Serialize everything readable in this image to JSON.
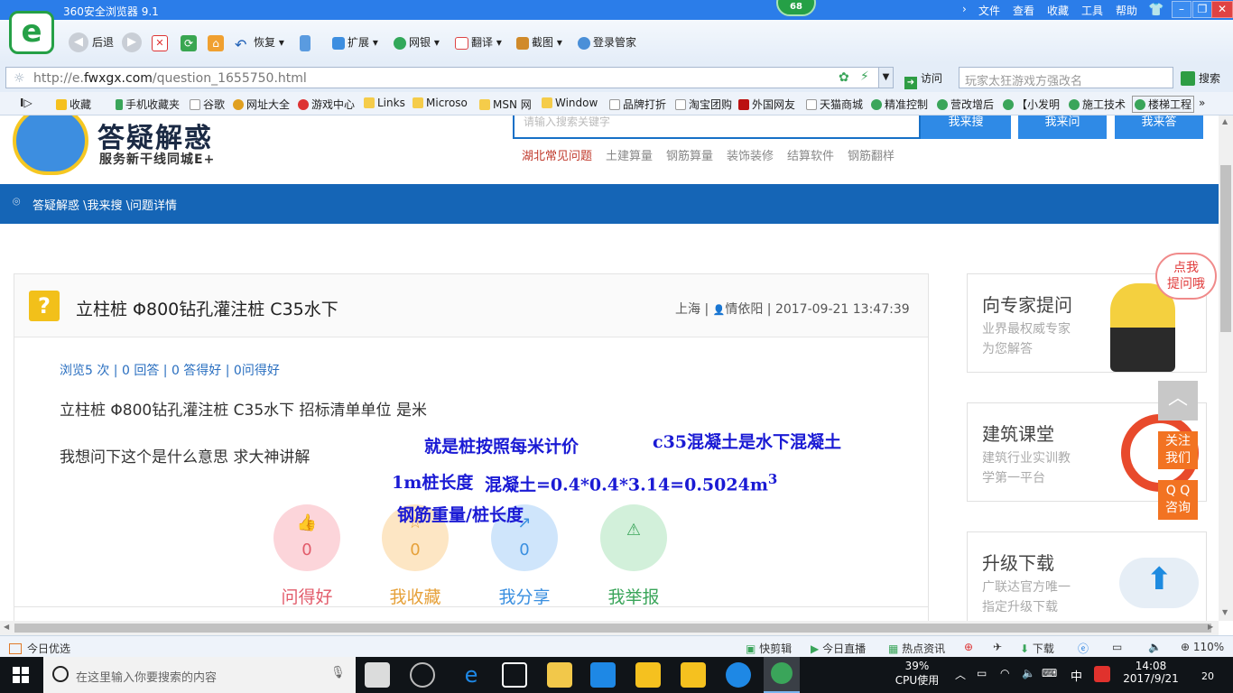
{
  "browser": {
    "title": "360安全浏览器 9.1",
    "badge": "68",
    "menu": [
      "文件",
      "查看",
      "收藏",
      "工具",
      "帮助"
    ],
    "toolbar": {
      "back": "后退",
      "restore": "恢复",
      "extensions": "扩展",
      "bank": "网银",
      "translate": "翻译",
      "screenshot": "截图",
      "login_manager": "登录管家"
    },
    "address": {
      "url_prefix": "http://e.",
      "url_domain": "fwxgx.com",
      "url_path": "/question_1655750.html",
      "visit": "访问",
      "search_placeholder": "玩家太狂游戏方强改名",
      "search_button": "搜索"
    },
    "bookmarks": [
      "收藏",
      "手机收藏夹",
      "谷歌",
      "网址大全",
      "游戏中心",
      "Links",
      "Microso",
      "MSN 网",
      "Window",
      "品牌打折",
      "淘宝团购",
      "外国网友",
      "天猫商城",
      "精准控制",
      "营改增后",
      "【小发明",
      "施工技术",
      "楼梯工程"
    ],
    "status": {
      "left": "今日优选",
      "items": [
        "快剪辑",
        "今日直播",
        "热点资讯",
        "下载"
      ],
      "zoom": "110%"
    }
  },
  "site": {
    "logo_title": "答疑解惑",
    "logo_subtitle": "服务新干线同城E+",
    "search_placeholder": "请输入搜索关键字",
    "buttons": [
      "我来搜",
      "我来问",
      "我来答"
    ],
    "hot_links": [
      "湖北常见问题",
      "土建算量",
      "钢筋算量",
      "装饰装修",
      "结算软件",
      "钢筋翻样"
    ],
    "breadcrumb": "答疑解惑 \\我来搜 \\问题详情"
  },
  "question": {
    "icon": "?",
    "title": "立柱桩 Φ800钻孔灌注桩 C35水下",
    "location": "上海",
    "user": "情依阳",
    "datetime": "2017-09-21 13:47:39",
    "stats": "浏览5 次 | 0 回答 | 0 答得好 | 0问得好",
    "body_line1": "立柱桩 Φ800钻孔灌注桩 C35水下     招标清单单位 是米",
    "body_line2": "我想问下这个是什么意思   求大神讲解",
    "actions": [
      {
        "label": "问得好",
        "count": "0",
        "color": "#e25b6a",
        "bg": "#fcd5da",
        "glyph": "👍"
      },
      {
        "label": "我收藏",
        "count": "0",
        "color": "#e6a13a",
        "bg": "#fde6c4",
        "glyph": "☆"
      },
      {
        "label": "我分享",
        "count": "0",
        "color": "#3a8fe0",
        "bg": "#cfe5fb",
        "glyph": "↗"
      },
      {
        "label": "我举报",
        "count": "0",
        "color": "#3aa55a",
        "bg": "#d2f0da",
        "glyph": "⚠"
      }
    ]
  },
  "annotations": {
    "a1": "就是桩按照每米计价",
    "a2": "c35混凝土是水下混凝土",
    "a3": "1m桩长度",
    "a4": "混凝土=0.4*0.4*3.14=0.5024m",
    "a4_sup": "3",
    "a5": "钢筋重量/桩长度"
  },
  "sidebar": {
    "ask_expert": {
      "title": "向专家提问",
      "desc1": "业界最权威专家",
      "desc2": "为您解答",
      "bubble1": "点我",
      "bubble2": "提问哦"
    },
    "course": {
      "title": "建筑课堂",
      "desc1": "建筑行业实训教",
      "desc2": "学第一平台"
    },
    "upgrade": {
      "title": "升级下载",
      "desc1": "广联达官方唯一",
      "desc2": "指定升级下载"
    },
    "follow": [
      "关注",
      "我们"
    ],
    "qq": [
      "Q Q",
      "咨询"
    ]
  },
  "taskbar": {
    "search_placeholder": "在这里输入你要搜索的内容",
    "cpu_percent": "39%",
    "cpu_label": "CPU使用",
    "ime": "中",
    "time": "14:08",
    "date": "2017/9/21",
    "notifications": "20"
  }
}
